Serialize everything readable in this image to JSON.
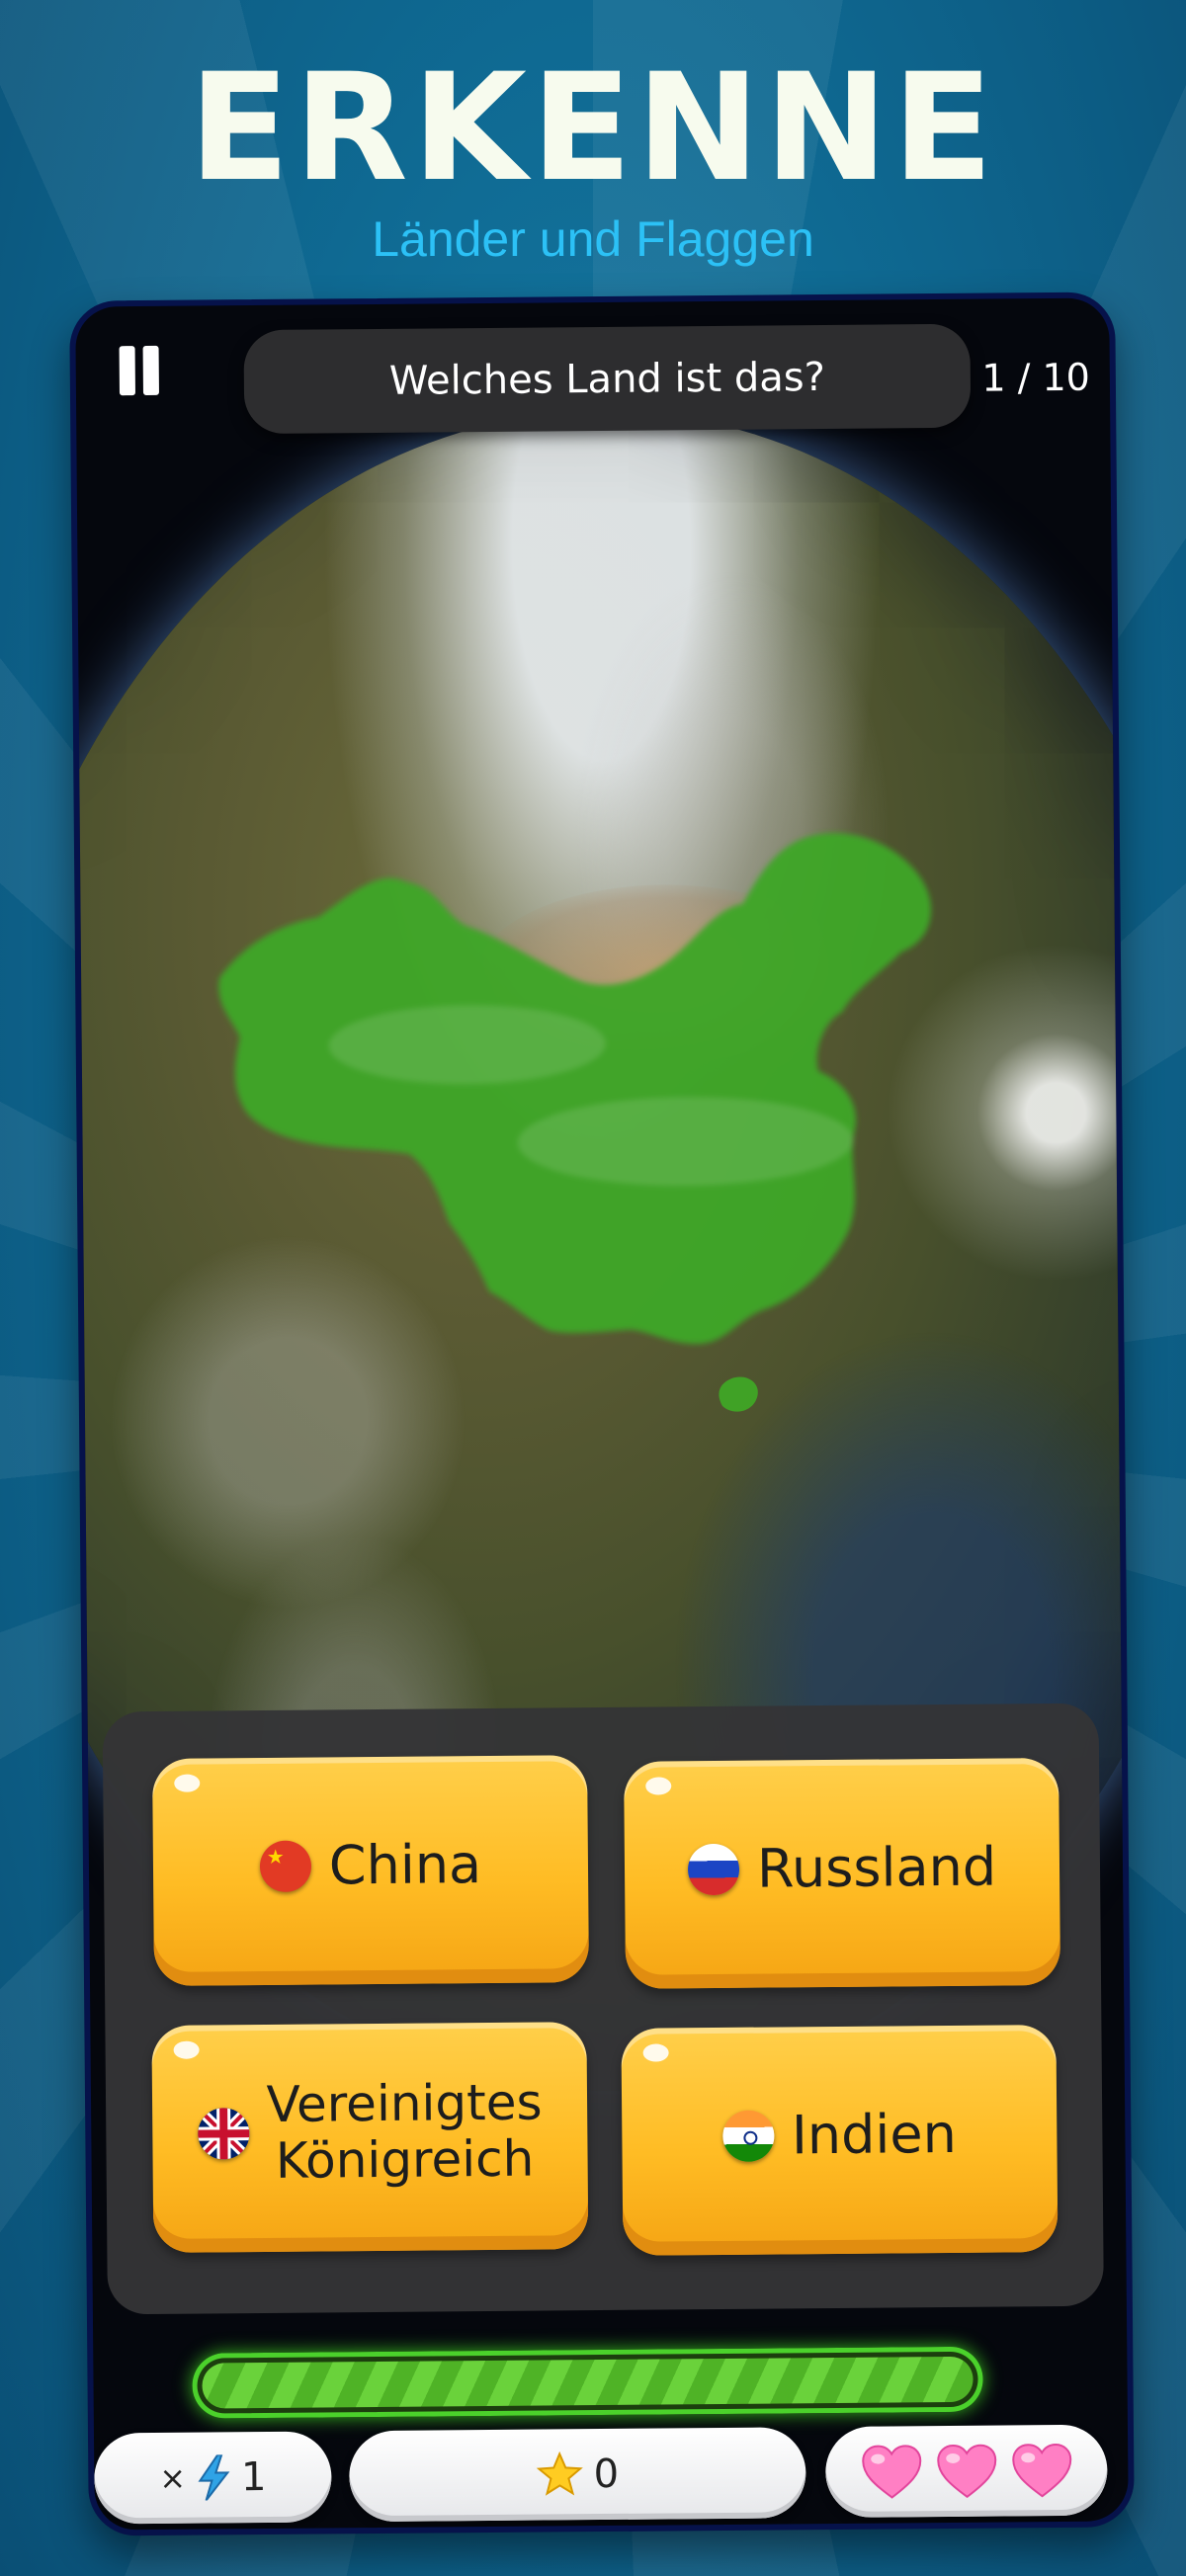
{
  "header": {
    "title": "ERKENNE",
    "subtitle": "Länder und Flaggen"
  },
  "game": {
    "question": "Welches Land ist das?",
    "progress": "1 / 10",
    "highlighted_country_color": "#3fa625",
    "answers": [
      {
        "label": "China",
        "flag": "cn"
      },
      {
        "label": "Russland",
        "flag": "ru"
      },
      {
        "label_line1": "Vereinigtes",
        "label_line2": "Königreich",
        "flag": "gb"
      },
      {
        "label": "Indien",
        "flag": "in"
      }
    ],
    "timer_remaining": 1.0
  },
  "hud": {
    "multiplier_prefix": "×",
    "multiplier_value": "1",
    "score": "0",
    "lives": 3
  },
  "icons": {
    "pause": "pause-icon",
    "bolt": "lightning-bolt-icon",
    "star": "star-icon",
    "heart": "heart-icon"
  },
  "colors": {
    "answer_button": "#ffbc24",
    "timer_green": "#4bd12b",
    "subtitle": "#2cc1f6",
    "heart": "#ff7fc4"
  }
}
